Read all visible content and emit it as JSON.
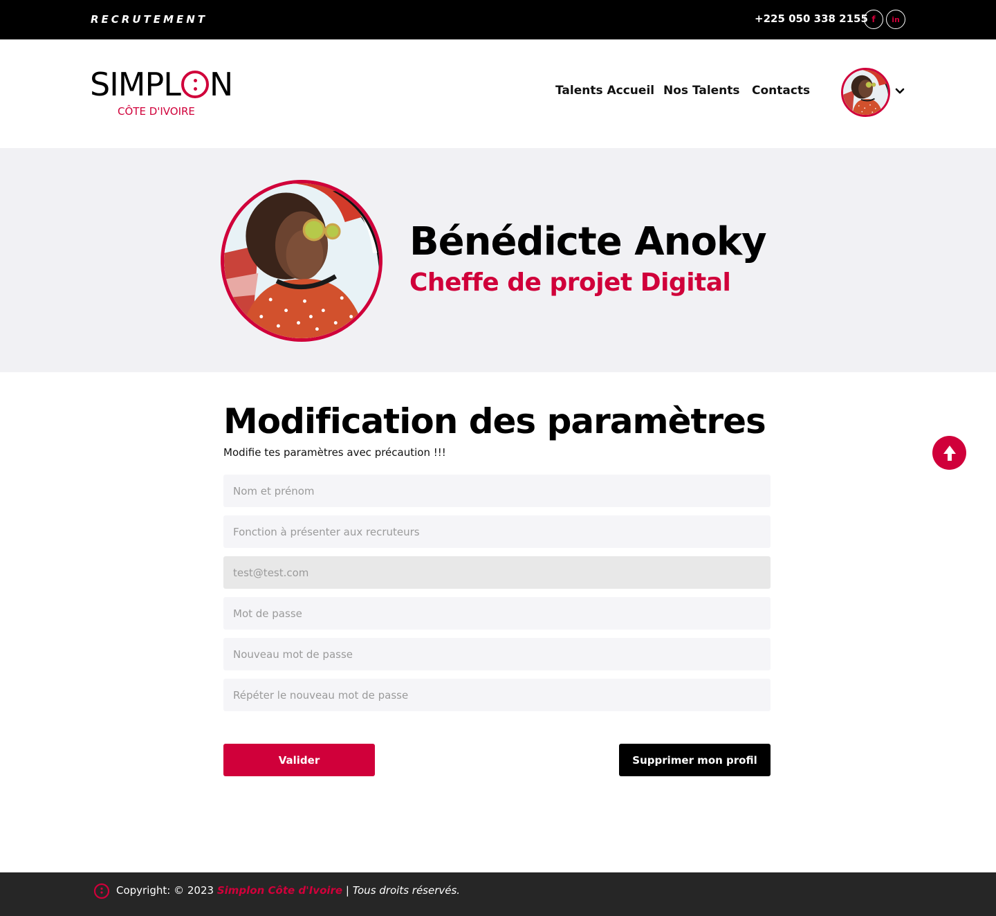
{
  "topbar": {
    "label": "RECRUTEMENT",
    "phone": "+225 050 338 2155",
    "facebook_glyph": "f",
    "linkedin_glyph": "in"
  },
  "header": {
    "logo_text_left": "SIMPL",
    "logo_text_right": "N",
    "logo_subtitle": "CÔTE D'IVOIRE",
    "nav": [
      "Talents Accueil",
      "Nos Talents",
      "Contacts"
    ]
  },
  "profile": {
    "name": "Bénédicte Anoky",
    "role": "Cheffe de projet Digital"
  },
  "form": {
    "title": "Modification des paramètres",
    "subtitle": "Modifie tes paramètres avec précaution !!!",
    "fields": {
      "name_placeholder": "Nom et prénom",
      "function_placeholder": "Fonction à présenter aux recruteurs",
      "email_placeholder": "test@test.com",
      "password_placeholder": "Mot de passe",
      "new_password_placeholder": "Nouveau mot de passe",
      "repeat_password_placeholder": "Répéter le nouveau mot de passe"
    },
    "validate_label": "Valider",
    "delete_label": "Supprimer mon profil"
  },
  "footer": {
    "copyright": "Copyright: © 2023",
    "brand": "Simplon Côte d'Ivoire",
    "rights": "| Tous droits réservés."
  },
  "colors": {
    "accent": "#d0003a",
    "topbar": "#000000",
    "banner": "#f1f1f4",
    "footer": "#262626"
  },
  "icons": {
    "facebook": "facebook-icon",
    "linkedin": "linkedin-icon",
    "chevron": "chevron-down-icon",
    "scroll_top": "arrow-up-icon",
    "footer_logo": "simplon-logo-icon"
  }
}
